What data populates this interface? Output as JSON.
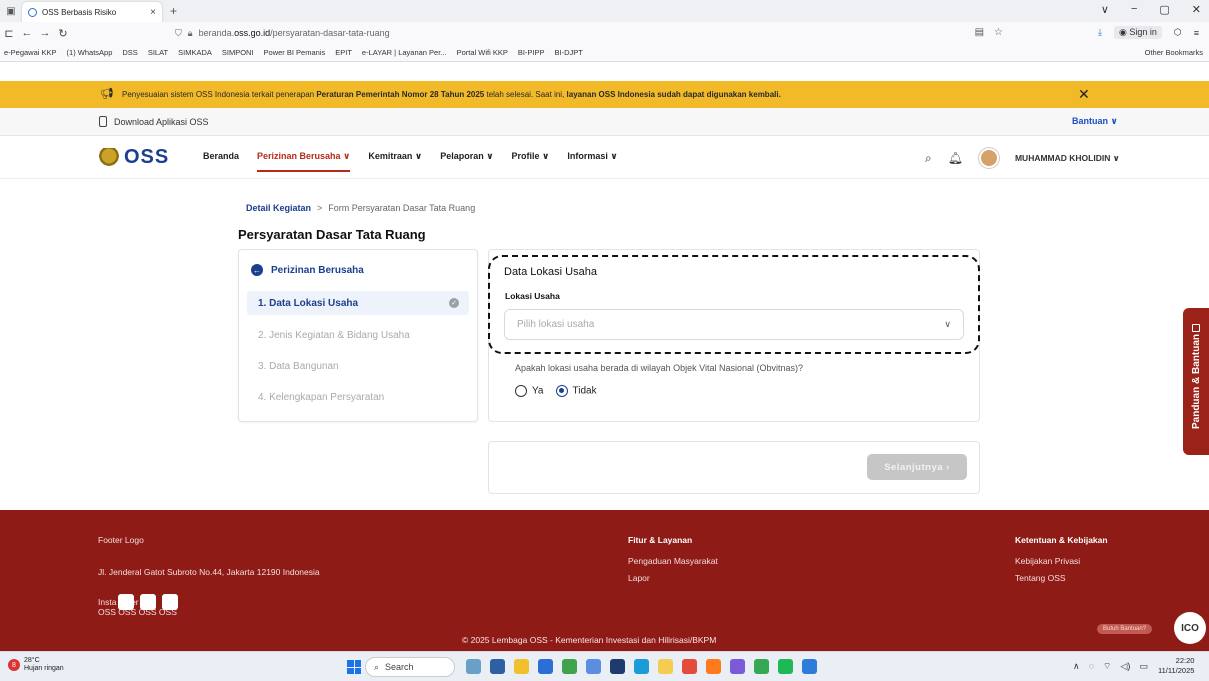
{
  "browser": {
    "tab_title": "OSS Berbasis Risiko",
    "tab_close": "×",
    "new_tab": "+",
    "url_prefix": "beranda.",
    "url_domain": "oss.go.id",
    "url_path": "/persyaratan-dasar-tata-ruang",
    "sign_in": "Sign in",
    "bookmarks": [
      "e-Pegawai KKP",
      "(1) WhatsApp",
      "DSS",
      "SILAT",
      "SIMKADA",
      "SIMPONI",
      "Power BI Pemanis",
      "EPIT",
      "e-LAYAR | Layanan Per...",
      "Portal Wifi KKP",
      "BI-PIPP",
      "BI-DJPT"
    ],
    "other_bookmarks": "Other Bookmarks"
  },
  "announcement": {
    "text_1": "Penyesuaian sistem OSS Indonesia terkait penerapan ",
    "text_bold_1": "Peraturan Pemerintah Nomor 28 Tahun 2025",
    "text_2": " telah selesai. Saat ini, ",
    "text_bold_2": "layanan OSS Indonesia sudah dapat digunakan kembali.",
    "close": "✕"
  },
  "appbar": {
    "download": "Download Aplikasi OSS",
    "help": "Bantuan ∨"
  },
  "nav": {
    "logo": "OSS",
    "items": [
      "Beranda",
      "Perizinan Berusaha ∨",
      "Kemitraan ∨",
      "Pelaporan ∨",
      "Profile ∨",
      "Informasi ∨"
    ],
    "user": "MUHAMMAD KHOLIDIN ∨"
  },
  "breadcrumb": {
    "link": "Detail Kegiatan",
    "sep": ">",
    "current": "Form Persyaratan Dasar Tata Ruang"
  },
  "page_title": "Persyaratan Dasar Tata Ruang",
  "steps": {
    "header": "Perizinan Berusaha",
    "items": [
      "1. Data Lokasi Usaha",
      "2. Jenis Kegiatan & Bidang Usaha",
      "3. Data Bangunan",
      "4. Kelengkapan Persyaratan"
    ]
  },
  "form": {
    "section_title": "Data Lokasi Usaha",
    "location_label": "Lokasi Usaha",
    "location_placeholder": "Pilih lokasi usaha",
    "question": "Apakah lokasi usaha berada di wilayah Objek Vital Nasional (Obvitnas)?",
    "option_yes": "Ya",
    "option_no": "Tidak",
    "selected": "Tidak",
    "next_button": "Selanjutnya  ›"
  },
  "side_tab": "Panduan & Bantuan",
  "footer": {
    "logo": "Footer Logo",
    "address": "Jl. Jenderal Gatot Subroto No.44, Jakarta 12190 Indonesia",
    "social_label": "Insta          F        tter",
    "social_names": "OSS  OSS  OSS  OSS",
    "col2_title": "Fitur & Layanan",
    "col2_items": [
      "Pengaduan Masyarakat",
      "Lapor"
    ],
    "col3_title": "Ketentuan & Kebijakan",
    "col3_items": [
      "Kebijakan Privasi",
      "Tentang OSS"
    ],
    "copyright": "© 2025 Lembaga OSS - Kementerian Investasi dan Hilirisasi/BKPM",
    "help_bubble": "Butuh Bantuan?",
    "help_icon": "ICO"
  },
  "taskbar": {
    "temp": "28°C",
    "weather": "Hujan ringan",
    "weather_badge": "8",
    "search": "Search",
    "time": "22:20",
    "date": "11/11/2025"
  },
  "colors": {
    "brand_red": "#8f1b17",
    "brand_blue": "#1b3f8f",
    "announcement": "#f2b929"
  }
}
